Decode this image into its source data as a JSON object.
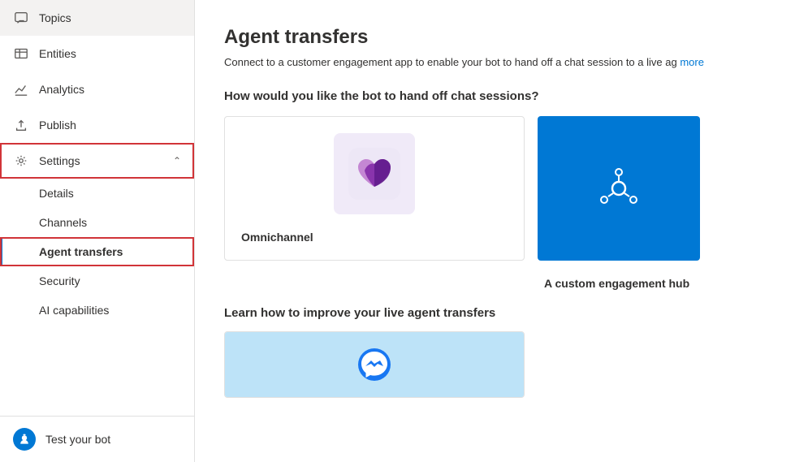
{
  "sidebar": {
    "items": [
      {
        "id": "topics",
        "label": "Topics",
        "icon": "speech-bubble-icon",
        "hasChildren": false
      },
      {
        "id": "entities",
        "label": "Entities",
        "icon": "table-icon",
        "hasChildren": false
      },
      {
        "id": "analytics",
        "label": "Analytics",
        "icon": "chart-icon",
        "hasChildren": false
      },
      {
        "id": "publish",
        "label": "Publish",
        "icon": "upload-icon",
        "hasChildren": false
      },
      {
        "id": "settings",
        "label": "Settings",
        "icon": "gear-icon",
        "hasChildren": true,
        "expanded": true,
        "children": [
          {
            "id": "details",
            "label": "Details"
          },
          {
            "id": "channels",
            "label": "Channels"
          },
          {
            "id": "agent-transfers",
            "label": "Agent transfers",
            "active": true
          },
          {
            "id": "security",
            "label": "Security"
          },
          {
            "id": "ai-capabilities",
            "label": "AI capabilities"
          }
        ]
      }
    ],
    "bottom": {
      "label": "Test your bot",
      "icon": "bot-icon"
    }
  },
  "main": {
    "title": "Agent transfers",
    "subtitle": "Connect to a customer engagement app to enable your bot to hand off a chat session to a live ag",
    "subtitle_link": "more",
    "section1_title": "How would you like the bot to hand off chat sessions?",
    "card1_label": "Omnichannel",
    "card2_label": "A custom engagement hub",
    "section2_title": "Learn how to improve your live agent transfers"
  },
  "colors": {
    "accent": "#0078d4",
    "active_border": "#d13438",
    "sidebar_bg": "#ffffff",
    "card_icon_bg": "#f0eaf8"
  }
}
